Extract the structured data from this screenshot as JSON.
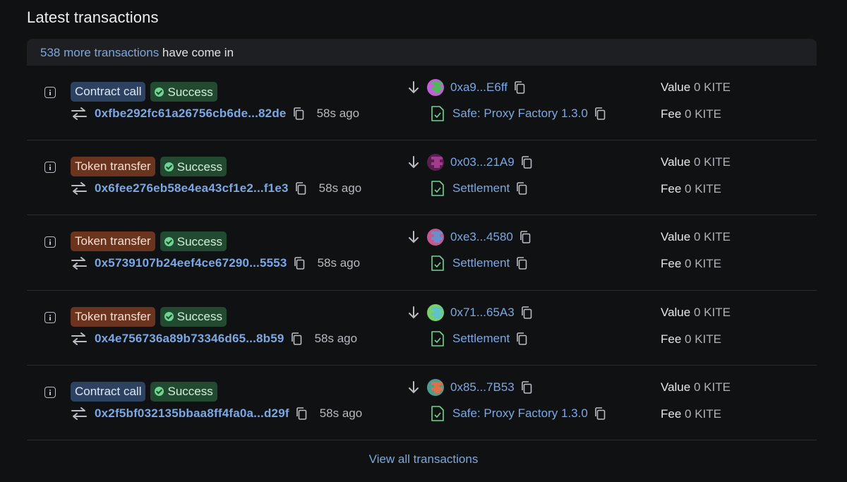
{
  "title": "Latest transactions",
  "banner": {
    "link": "538 more transactions",
    "rest": " have come in"
  },
  "rows": [
    {
      "type": "Contract call",
      "type_kind": "contract",
      "status": "Success",
      "hash": "0xfbe292fc61a26756cb6de...82de",
      "age": "58s ago",
      "from": "0xa9...E6ff",
      "to": "Safe: Proxy Factory 1.3.0",
      "value_label": "Value",
      "value": "0 KITE",
      "fee_label": "Fee",
      "fee": "0 KITE",
      "avatar_colors": [
        "#4fb85a",
        "#c45ed9"
      ]
    },
    {
      "type": "Token transfer",
      "type_kind": "token",
      "status": "Success",
      "hash": "0x6fee276eb58e4ea43cf1e2...f1e3",
      "age": "58s ago",
      "from": "0x03...21A9",
      "to": "Settlement",
      "value_label": "Value",
      "value": "0 KITE",
      "fee_label": "Fee",
      "fee": "0 KITE",
      "avatar_colors": [
        "#a23c8e",
        "#5a1f4f"
      ]
    },
    {
      "type": "Token transfer",
      "type_kind": "token",
      "status": "Success",
      "hash": "0x5739107b24eef4ce67290...5553",
      "age": "58s ago",
      "from": "0xe3...4580",
      "to": "Settlement",
      "value_label": "Value",
      "value": "0 KITE",
      "fee_label": "Fee",
      "fee": "0 KITE",
      "avatar_colors": [
        "#6a8fcf",
        "#c05a8f"
      ]
    },
    {
      "type": "Token transfer",
      "type_kind": "token",
      "status": "Success",
      "hash": "0x4e756736a89b73346d65...8b59",
      "age": "58s ago",
      "from": "0x71...65A3",
      "to": "Settlement",
      "value_label": "Value",
      "value": "0 KITE",
      "fee_label": "Fee",
      "fee": "0 KITE",
      "avatar_colors": [
        "#5ec2c9",
        "#78d06a"
      ]
    },
    {
      "type": "Contract call",
      "type_kind": "contract",
      "status": "Success",
      "hash": "0x2f5bf032135bbaa8ff4fa0a...d29f",
      "age": "58s ago",
      "from": "0x85...7B53",
      "to": "Safe: Proxy Factory 1.3.0",
      "value_label": "Value",
      "value": "0 KITE",
      "fee_label": "Fee",
      "fee": "0 KITE",
      "avatar_colors": [
        "#e0704a",
        "#4f9c8f"
      ]
    }
  ],
  "footer_link": "View all transactions",
  "colors": {
    "accent": "#7aa8e4",
    "success_bg": "#224a31",
    "token_bg": "#6b341f",
    "contract_bg": "#2d4260"
  }
}
